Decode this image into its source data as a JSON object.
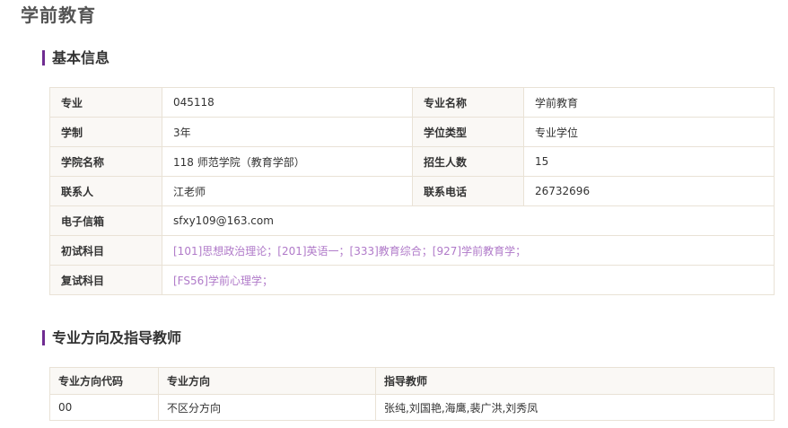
{
  "page_title": "学前教育",
  "basic_section": {
    "title": "基本信息",
    "major_code_label": "专业",
    "major_code": "045118",
    "major_name_label": "专业名称",
    "major_name": "学前教育",
    "duration_label": "学制",
    "duration": "3年",
    "degree_type_label": "学位类型",
    "degree_type": "专业学位",
    "college_label": "学院名称",
    "college": "118 师范学院（教育学部）",
    "enrollment_label": "招生人数",
    "enrollment": "15",
    "contact_label": "联系人",
    "contact": "江老师",
    "phone_label": "联系电话",
    "phone": "26732696",
    "email_label": "电子信箱",
    "email": "sfxy109@163.com",
    "prelim_label": "初试科目",
    "prelim_subjects": "[101]思想政治理论；[201]英语一；[333]教育综合；[927]学前教育学；",
    "retest_label": "复试科目",
    "retest_subjects": "[FS56]学前心理学；"
  },
  "direction_section": {
    "title": "专业方向及指导教师",
    "headers": [
      "专业方向代码",
      "专业方向",
      "指导教师"
    ],
    "rows": [
      [
        "00",
        "不区分方向",
        "张纯,刘国艳,海鹰,裴广洪,刘秀凤"
      ]
    ]
  },
  "colors": {
    "accent": "#6f2c91",
    "subject_link": "#b07ac9",
    "label_bg": "#faf8f5",
    "border": "#e9e2d6"
  }
}
